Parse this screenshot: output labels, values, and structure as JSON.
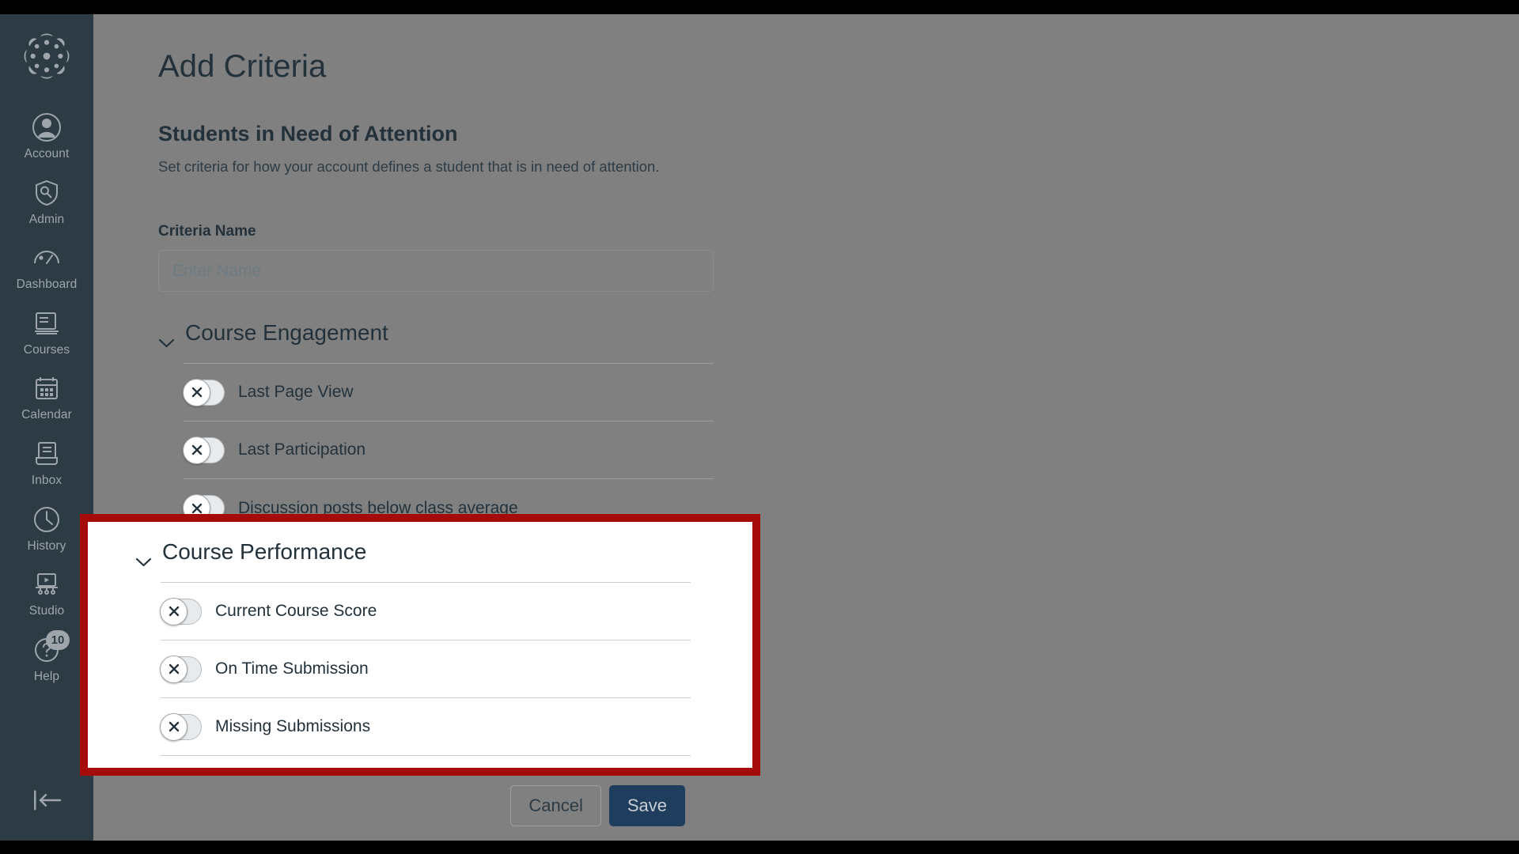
{
  "sidebar": {
    "logo_icon": "canvas-logo-icon",
    "items": [
      {
        "id": "account",
        "label": "Account",
        "icon": "user-circle-icon"
      },
      {
        "id": "admin",
        "label": "Admin",
        "icon": "shield-wrench-icon"
      },
      {
        "id": "dashboard",
        "label": "Dashboard",
        "icon": "gauge-icon"
      },
      {
        "id": "courses",
        "label": "Courses",
        "icon": "book-icon"
      },
      {
        "id": "calendar",
        "label": "Calendar",
        "icon": "calendar-icon"
      },
      {
        "id": "inbox",
        "label": "Inbox",
        "icon": "inbox-tray-icon"
      },
      {
        "id": "history",
        "label": "History",
        "icon": "clock-icon"
      },
      {
        "id": "studio",
        "label": "Studio",
        "icon": "studio-screen-icon"
      },
      {
        "id": "help",
        "label": "Help",
        "icon": "question-face-icon",
        "badge": "10"
      }
    ],
    "collapse_icon": "collapse-left-icon"
  },
  "page": {
    "title": "Add Criteria",
    "section_heading": "Students in Need of Attention",
    "section_description": "Set criteria for how your account defines a student that is in need of attention."
  },
  "criteria_name": {
    "label": "Criteria Name",
    "value": "",
    "placeholder": "Enter Name"
  },
  "groups": [
    {
      "id": "course-engagement",
      "title": "Course Engagement",
      "expanded": true,
      "chevron_icon": "chevron-down-icon",
      "rows": [
        {
          "label": "Last Page View",
          "toggle": "off",
          "toggle_icon": "x-icon"
        },
        {
          "label": "Last Participation",
          "toggle": "off",
          "toggle_icon": "x-icon"
        },
        {
          "label": "Discussion posts below class average",
          "toggle": "off",
          "toggle_icon": "x-icon"
        }
      ]
    },
    {
      "id": "course-performance",
      "title": "Course Performance",
      "expanded": true,
      "highlighted": true,
      "chevron_icon": "chevron-down-icon",
      "rows": [
        {
          "label": "Current Course Score",
          "toggle": "off",
          "toggle_icon": "x-icon"
        },
        {
          "label": "On Time Submission",
          "toggle": "off",
          "toggle_icon": "x-icon"
        },
        {
          "label": "Missing Submissions",
          "toggle": "off",
          "toggle_icon": "x-icon"
        }
      ]
    }
  ],
  "footer": {
    "cancel_label": "Cancel",
    "save_label": "Save"
  },
  "colors": {
    "sidebar_bg": "#2D3B45",
    "scrim": "#808080",
    "highlight_border": "#A50B0B",
    "save_bg": "#1F3D5C",
    "text": "#23313B"
  }
}
